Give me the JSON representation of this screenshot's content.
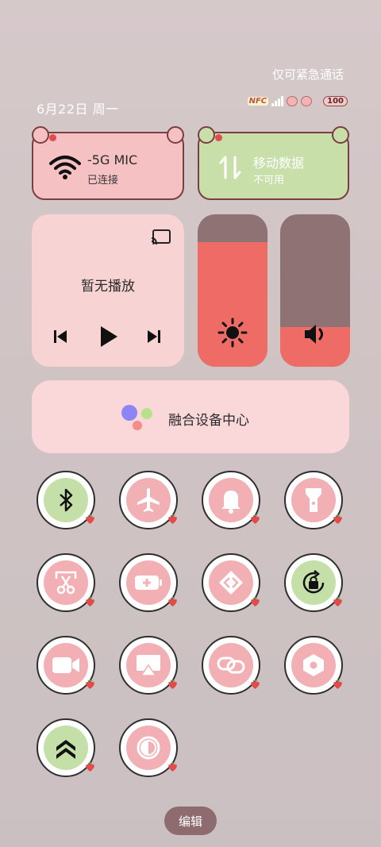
{
  "status": {
    "emergency_text": "仅可紧急通话",
    "date": "6月22日 周一",
    "nfc_label": "NFC",
    "battery": "100"
  },
  "wifi_tile": {
    "title": "-5G MIC",
    "subtitle": "已连接",
    "icon": "wifi-icon"
  },
  "mobile_tile": {
    "title": "移动数据",
    "subtitle": "不可用",
    "icon": "mobile-data-icon"
  },
  "media": {
    "status": "暂无播放"
  },
  "sliders": {
    "brightness_level": 0.82,
    "volume_level": 0.26
  },
  "device_center": {
    "label": "融合设备中心"
  },
  "quick_toggles": [
    {
      "name": "bluetooth",
      "active": true
    },
    {
      "name": "airplane-mode",
      "active": false
    },
    {
      "name": "ring-mode",
      "active": false
    },
    {
      "name": "flashlight",
      "active": false
    },
    {
      "name": "screenshot",
      "active": false
    },
    {
      "name": "battery-saver",
      "active": false
    },
    {
      "name": "nearby-share",
      "active": false
    },
    {
      "name": "rotation-lock",
      "active": true
    },
    {
      "name": "screen-record",
      "active": false
    },
    {
      "name": "screen-cast",
      "active": false
    },
    {
      "name": "link-share",
      "active": false
    },
    {
      "name": "super-power-saving",
      "active": false
    },
    {
      "name": "performance-mode",
      "active": true
    },
    {
      "name": "dark-mode",
      "active": false
    }
  ],
  "edit_label": "编辑",
  "colors": {
    "pink_tile": "#f6c1c3",
    "green_tile": "#c8dfaa",
    "slider_fill": "#ef6b66",
    "slider_track": "#8f7374",
    "toggle_pink": "#f2b0b5",
    "toggle_green": "#c4e0a8"
  }
}
